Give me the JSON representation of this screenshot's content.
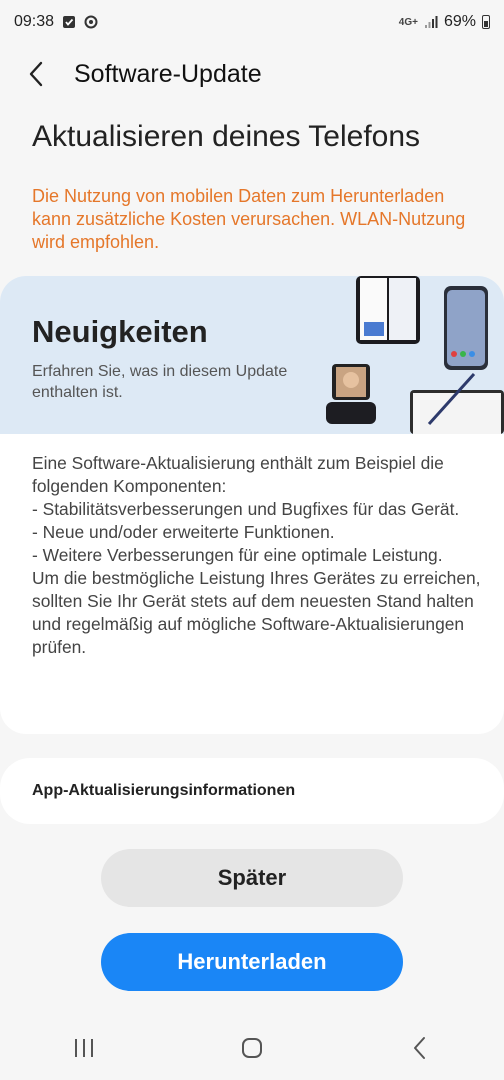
{
  "status_bar": {
    "time": "09:38",
    "network": "4G+",
    "battery_percent": "69%",
    "icons": [
      "checkbox-notification-icon",
      "sync-notification-icon",
      "signal-icon",
      "battery-icon"
    ]
  },
  "app_bar": {
    "back_icon": "chevron-left-icon",
    "title": "Software-Update"
  },
  "main": {
    "heading": "Aktualisieren deines Telefons",
    "warning": "Die Nutzung von mobilen Daten zum Herunterladen kann zusätzliche Kosten verursachen. WLAN-Nutzung wird empfohlen.",
    "warning_color": "#e5772a"
  },
  "news_card": {
    "title": "Neuigkeiten",
    "subtitle": "Erfahren Sie, was in diesem Update enthalten ist.",
    "body": "Eine Software-Aktualisierung enthält zum Beispiel die folgenden Komponenten:\n - Stabilitätsverbesserungen und Bugfixes für das Gerät.\n - Neue und/oder erweiterte Funktionen.\n - Weitere Verbesserungen für eine optimale Leistung.\nUm die bestmögliche Leistung Ihres Gerätes zu erreichen, sollten Sie Ihr Gerät stets auf dem neuesten Stand halten und regelmäßig auf mögliche Software-Aktualisierungen prüfen.",
    "banner_color": "#dde9f5"
  },
  "app_update_info": {
    "label": "App-Aktualisierungsinformationen"
  },
  "buttons": {
    "later": "Später",
    "download": "Herunterladen",
    "download_color": "#1a86f6"
  },
  "nav_bar": {
    "icons": [
      "recent-apps-icon",
      "home-icon",
      "back-icon"
    ]
  }
}
